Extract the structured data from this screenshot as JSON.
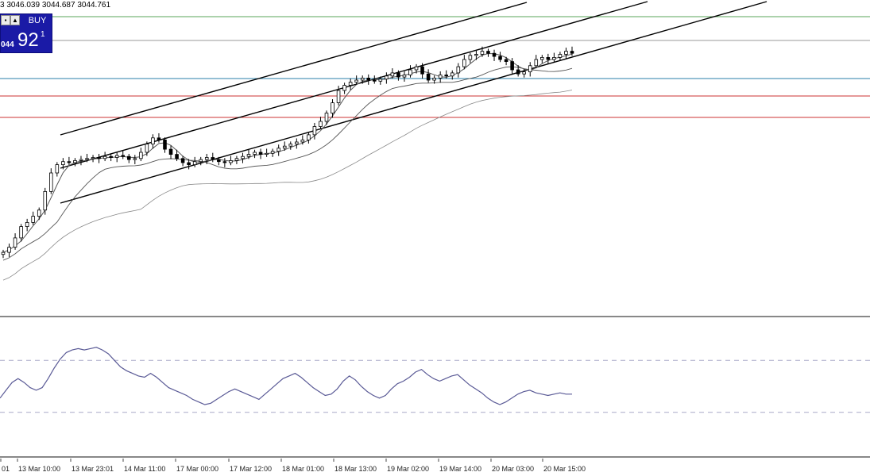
{
  "header": {
    "ohlc_text": "3 3046.039 3044.687 3044.761"
  },
  "trade_panel": {
    "buy_label": "BUY",
    "bid_small": "044",
    "bid_big": "92",
    "bid_sup": "1",
    "up_arrow_icon": "triangle-up-icon",
    "box_icon": "square-icon"
  },
  "colors": {
    "candle": "#000000",
    "channel": "#000000",
    "ma": "#555555",
    "green_level": "#5aa65a",
    "grey_level": "#9a9a9a",
    "blue_level": "#2a7fa8",
    "red_level": "#cc3333",
    "oscillator": "#5a5a96",
    "panel": "#1a1aa6"
  },
  "chart_data": {
    "type": "line",
    "x_ticks": [
      "01",
      "13 Mar 10:00",
      "13 Mar 23:01",
      "14 Mar 11:00",
      "17 Mar 00:00",
      "17 Mar 12:00",
      "18 Mar 01:00",
      "18 Mar 13:00",
      "19 Mar 02:00",
      "19 Mar 14:00",
      "20 Mar 03:00",
      "20 Mar 15:00"
    ],
    "series": [
      {
        "values": [
          3.0,
          8.0,
          17.0,
          28.0,
          32.0,
          38.0,
          44.0,
          62.0,
          80.0,
          88.0,
          91.0,
          90.0,
          92.0,
          93.0,
          94.0,
          95.0,
          94.0,
          96.0,
          95.0,
          97.0,
          96.0,
          93.0,
          94.0,
          100.0,
          108.0,
          114.0,
          112.0,
          103.0,
          98.0,
          94.0,
          90.0,
          88.0,
          91.0,
          93.0,
          95.0,
          93.0,
          91.0,
          90.0,
          92.0,
          94.0,
          96.0,
          98.0,
          100.0,
          98.0,
          99.0,
          101.0,
          104.0,
          106.0,
          108.0,
          110.0,
          112.0,
          117.0,
          125.0,
          130.0,
          138.0,
          148.0,
          160.0,
          165.0,
          168.0,
          170.0,
          172.0,
          170.0,
          169.0,
          171.0,
          174.0,
          177.0,
          173.0,
          175.0,
          180.0,
          183.0,
          176.0,
          170.0,
          172.0,
          175.0,
          174.0,
          177.0,
          183.0,
          190.0,
          194.0,
          195.0,
          198.0,
          196.0,
          193.0,
          190.0,
          188.0,
          180.0,
          176.0,
          178.0,
          184.0,
          190.0,
          192.0,
          190.0,
          192.0,
          195.0,
          198.0,
          196.0
        ]
      }
    ],
    "rsi": [
      41.0,
      47.0,
      53.0,
      56.0,
      53.0,
      49.0,
      47.0,
      49.0,
      56.0,
      64.0,
      71.0,
      76.0,
      78.0,
      79.0,
      78.0,
      79.0,
      80.0,
      78.0,
      75.0,
      70.0,
      65.0,
      62.0,
      60.0,
      58.0,
      57.0,
      60.0,
      57.0,
      53.0,
      49.0,
      47.0,
      45.0,
      43.0,
      40.0,
      38.0,
      36.0,
      37.0,
      40.0,
      43.0,
      46.0,
      48.0,
      46.0,
      44.0,
      42.0,
      40.0,
      44.0,
      48.0,
      52.0,
      56.0,
      58.0,
      60.0,
      57.0,
      53.0,
      49.0,
      46.0,
      43.0,
      44.0,
      48.0,
      54.0,
      58.0,
      55.0,
      50.0,
      46.0,
      43.0,
      41.0,
      43.0,
      48.0,
      52.0,
      54.0,
      57.0,
      61.0,
      63.0,
      59.0,
      56.0,
      54.0,
      56.0,
      58.0,
      59.0,
      55.0,
      51.0,
      48.0,
      45.0,
      41.0,
      38.0,
      36.0,
      38.0,
      41.0,
      44.0,
      46.0,
      47.0,
      45.0,
      44.0,
      43.0,
      44.0,
      45.0,
      44.0,
      44.0
    ],
    "rsi_levels": [
      70,
      30
    ],
    "horizontal_levels": [
      "green",
      "grey",
      "blue",
      "red",
      "red"
    ],
    "grid": false
  }
}
